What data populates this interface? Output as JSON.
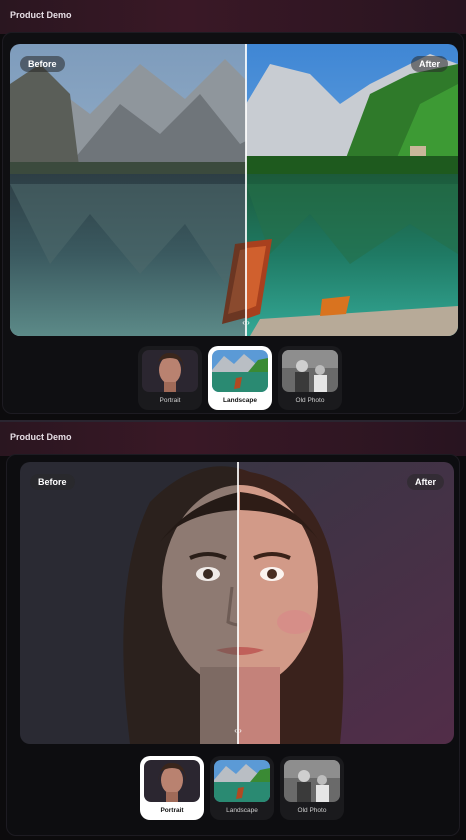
{
  "sections": [
    {
      "title": "Product Demo",
      "before_label": "Before",
      "after_label": "After",
      "handle_glyph": "‹ ›",
      "active_thumb": "Landscape",
      "thumbs": [
        {
          "label": "Portrait",
          "icon": "portrait-thumb-icon"
        },
        {
          "label": "Landscape",
          "icon": "landscape-thumb-icon"
        },
        {
          "label": "Old Photo",
          "icon": "old-photo-thumb-icon"
        }
      ]
    },
    {
      "title": "Product Demo",
      "before_label": "Before",
      "after_label": "After",
      "handle_glyph": "‹ ›",
      "active_thumb": "Portrait",
      "thumbs": [
        {
          "label": "Portrait",
          "icon": "portrait-thumb-icon"
        },
        {
          "label": "Landscape",
          "icon": "landscape-thumb-icon"
        },
        {
          "label": "Old Photo",
          "icon": "old-photo-thumb-icon"
        }
      ]
    }
  ],
  "colors": {
    "header_gradient": "#3a1826",
    "active_thumb_bg": "#ffffff",
    "divider": "#ffffff"
  }
}
